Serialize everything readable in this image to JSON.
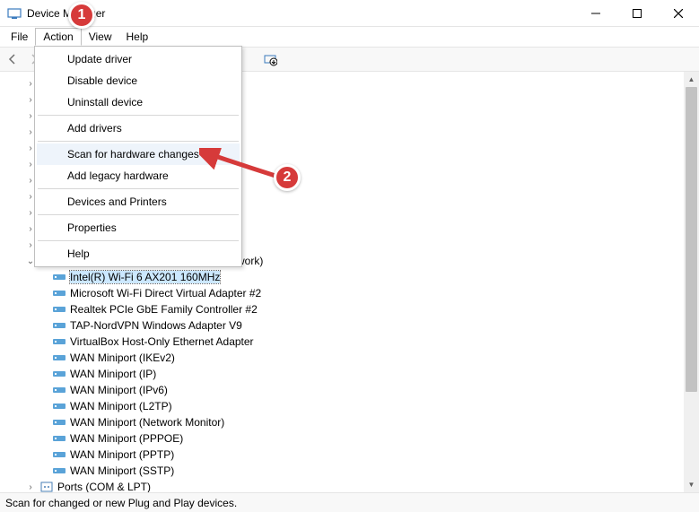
{
  "window": {
    "title": "Device Manager"
  },
  "menubar": {
    "file": "File",
    "action": "Action",
    "view": "View",
    "help": "Help"
  },
  "dropdown": {
    "update_driver": "Update driver",
    "disable_device": "Disable device",
    "uninstall_device": "Uninstall device",
    "add_drivers": "Add drivers",
    "scan_hardware": "Scan for hardware changes",
    "add_legacy": "Add legacy hardware",
    "devices_printers": "Devices and Printers",
    "properties": "Properties",
    "help": "Help"
  },
  "tree": {
    "visible_partial_label": "work)",
    "items": [
      "Intel(R) Wi-Fi 6 AX201 160MHz",
      "Microsoft Wi-Fi Direct Virtual Adapter #2",
      "Realtek PCIe GbE Family Controller #2",
      "TAP-NordVPN Windows Adapter V9",
      "VirtualBox Host-Only Ethernet Adapter",
      "WAN Miniport (IKEv2)",
      "WAN Miniport (IP)",
      "WAN Miniport (IPv6)",
      "WAN Miniport (L2TP)",
      "WAN Miniport (Network Monitor)",
      "WAN Miniport (PPPOE)",
      "WAN Miniport (PPTP)",
      "WAN Miniport (SSTP)"
    ],
    "next_category": "Ports (COM & LPT)"
  },
  "statusbar": {
    "text": "Scan for changed or new Plug and Play devices."
  },
  "annotations": {
    "one": "1",
    "two": "2"
  }
}
